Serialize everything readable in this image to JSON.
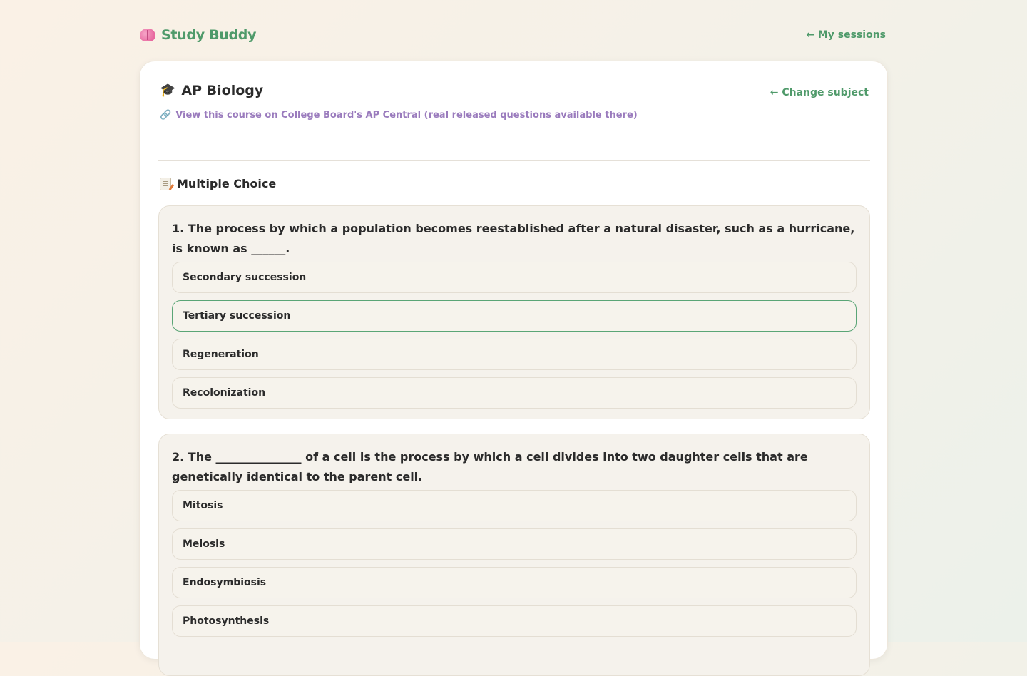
{
  "header": {
    "brand_name": "Study Buddy",
    "brand_icon": "brain-icon",
    "my_sessions_label": "← My sessions"
  },
  "course": {
    "title": "AP Biology",
    "icon": "graduation-cap-icon",
    "change_subject_label": "← Change subject",
    "ap_link_label": "View this course on College Board's AP Central (real released questions available there)",
    "ap_link_icon": "link-icon"
  },
  "section": {
    "title": "Multiple Choice",
    "icon": "memo-icon"
  },
  "questions": [
    {
      "text": "1. The process by which a population becomes reestablished after a natural disaster, such as a hurricane, is known as ______.",
      "options": [
        "Secondary succession",
        "Tertiary succession",
        "Regeneration",
        "Recolonization"
      ]
    },
    {
      "text": "2. The _______________ of a cell is the process by which a cell divides into two daughter cells that are genetically identical to the parent cell.",
      "options": [
        "Mitosis",
        "Meiosis",
        "Endosymbiosis",
        "Photosynthesis"
      ]
    }
  ],
  "colors": {
    "accent_green": "#4f9a6a",
    "link_purple": "#9a7bbd",
    "hover_border": "#5aa576"
  }
}
